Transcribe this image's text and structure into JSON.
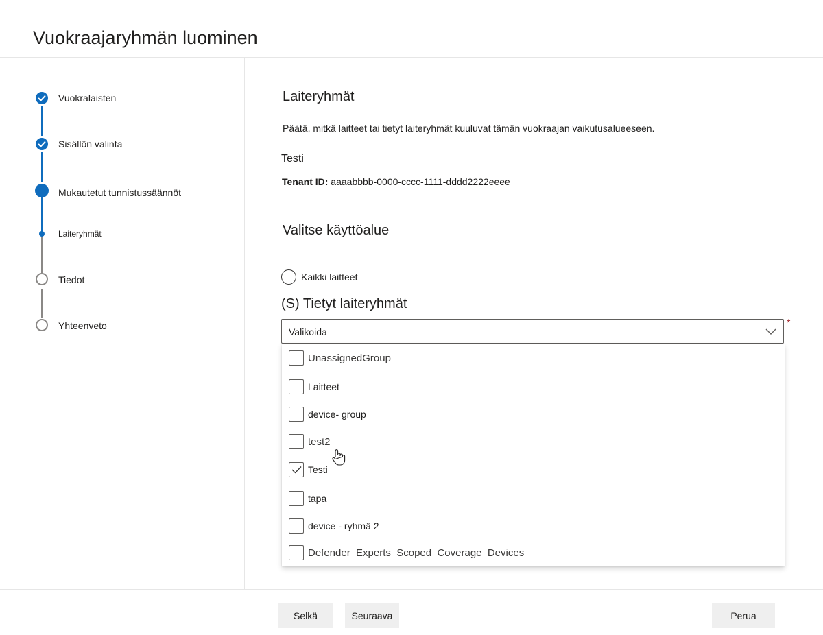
{
  "header": {
    "title": "Vuokraajaryhmän luominen"
  },
  "sidebar": {
    "steps": [
      {
        "label": "Vuokralaisten",
        "state": "completed"
      },
      {
        "label": "Sisällön valinta",
        "state": "completed"
      },
      {
        "label": "Mukautetut tunnistussäännöt",
        "state": "current"
      },
      {
        "label": "Laiteryhmät",
        "state": "current-substep"
      },
      {
        "label": "Tiedot",
        "state": "pending"
      },
      {
        "label": "Yhteenveto",
        "state": "pending"
      }
    ]
  },
  "main": {
    "section_title": "Laiteryhmät",
    "description": "Päätä, mitkä laitteet tai tietyt laiteryhmät kuuluvat tämän vuokraajan vaikutusalueeseen.",
    "tenant_name": "Testi",
    "tenant_id_label": "Tenant ID:",
    "tenant_id_value": "aaaabbbb-0000-cccc-1111-dddd2222eeee",
    "scope_title": "Valitse käyttöalue",
    "radio_all_label": "Kaikki laitteet",
    "specific_groups_label": "(S) Tietyt laiteryhmät",
    "dropdown_value": "Valikoida",
    "required_mark": "*",
    "options": [
      {
        "label": "UnassignedGroup",
        "checked": false
      },
      {
        "label": "Laitteet",
        "checked": false
      },
      {
        "label": "device- group",
        "checked": false
      },
      {
        "label": "test2",
        "checked": false
      },
      {
        "label": "Testi",
        "checked": true
      },
      {
        "label": "tapa",
        "checked": false
      },
      {
        "label": "device - ryhmä 2",
        "checked": false
      },
      {
        "label": "Defender_Experts_Scoped_Coverage_Devices",
        "checked": false
      }
    ]
  },
  "footer": {
    "back_label": "Selkä",
    "next_label": "Seuraava",
    "cancel_label": "Perua"
  },
  "colors": {
    "accent": "#0f6cbd",
    "pending": "#8a8886",
    "required": "#a4262c"
  },
  "icons": {
    "completed_step": "checkmark-circle-icon",
    "dropdown": "chevron-down-icon",
    "cursor": "hand-pointer-icon",
    "checkbox_checked": "checkmark-icon"
  }
}
